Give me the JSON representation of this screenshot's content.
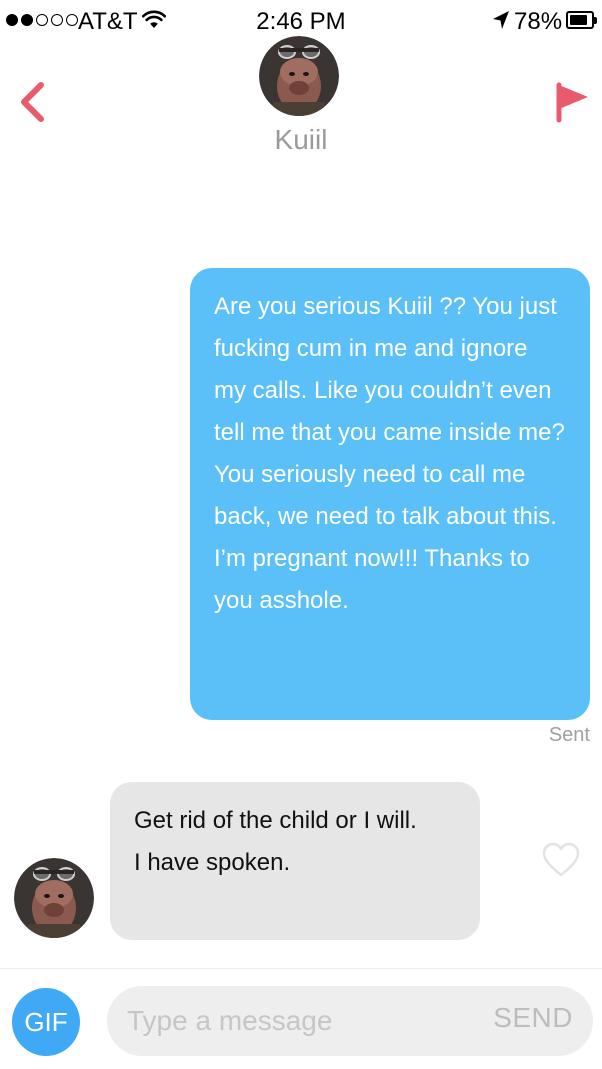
{
  "status_bar": {
    "signal_filled": 2,
    "signal_total": 5,
    "carrier": "AT&T",
    "time": "2:46 PM",
    "battery_percent": "78%",
    "battery_level": 0.78
  },
  "header": {
    "contact_name": "Kuiil",
    "back_icon": "chevron-left-icon",
    "flag_icon": "flag-icon",
    "accent_color": "#e85a6c"
  },
  "messages": {
    "sent": {
      "text": "Are you serious Kuiil ?? You just fucking cum in me and ignore my calls. Like you couldn’t even tell me that you came inside me?\nYou seriously need to call me back, we need to talk about this.\nI’m pregnant now!!! Thanks to you asshole.",
      "status": "Sent",
      "color": "#5bc0f8"
    },
    "received": {
      "text": "Get rid of the child or I will.\nI have spoken.",
      "color": "#e6e6e6",
      "like_icon": "heart-outline-icon"
    }
  },
  "compose": {
    "gif_label": "GIF",
    "placeholder": "Type a message",
    "value": "",
    "send_label": "SEND",
    "gif_color": "#3fa9f5"
  }
}
